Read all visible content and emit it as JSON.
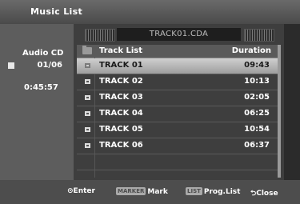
{
  "title": "Music List",
  "left": {
    "source": "Audio CD",
    "count": "01/06",
    "total_time": "0:45:57"
  },
  "now_playing": "TRACK01.CDA",
  "list": {
    "header_name": "Track List",
    "header_duration": "Duration",
    "tracks": [
      {
        "name": "TRACK 01",
        "duration": "09:43"
      },
      {
        "name": "TRACK 02",
        "duration": "10:13"
      },
      {
        "name": "TRACK 03",
        "duration": "02:05"
      },
      {
        "name": "TRACK 04",
        "duration": "06:25"
      },
      {
        "name": "TRACK 05",
        "duration": "10:54"
      },
      {
        "name": "TRACK 06",
        "duration": "06:37"
      }
    ]
  },
  "footer": {
    "enter_glyph": "⊙",
    "enter": "Enter",
    "marker_key": "MARKER",
    "mark": "Mark",
    "list_key": "LIST",
    "prog_list": "Prog.List",
    "close_glyph": "⮌",
    "close": "Close"
  },
  "icons": [
    "cd-icon",
    "folder-icon",
    "track-icon",
    "grill-icon"
  ]
}
